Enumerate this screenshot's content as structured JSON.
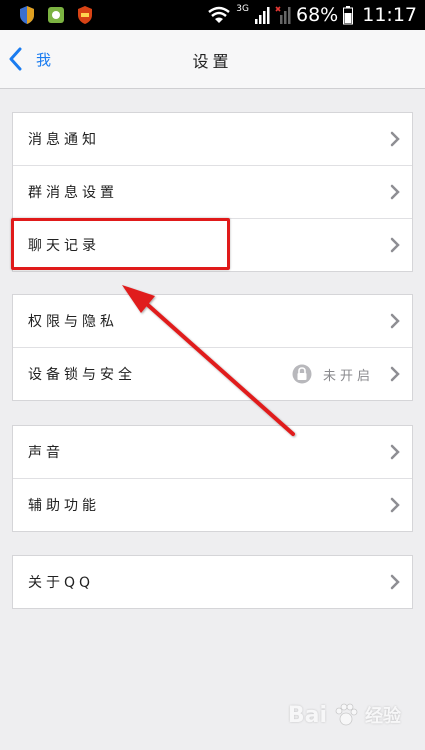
{
  "status_bar": {
    "network": "3G",
    "battery_percent": "68%",
    "time": "11:17"
  },
  "nav": {
    "back_label": "我",
    "title": "设置"
  },
  "groups": [
    {
      "items": [
        {
          "label": "消息通知"
        },
        {
          "label": "群消息设置"
        },
        {
          "label": "聊天记录"
        }
      ]
    },
    {
      "items": [
        {
          "label": "权限与隐私"
        },
        {
          "label": "设备锁与安全",
          "value": "未开启"
        }
      ]
    },
    {
      "items": [
        {
          "label": "声音"
        },
        {
          "label": "辅助功能"
        }
      ]
    },
    {
      "items": [
        {
          "label": "关于QQ"
        }
      ]
    }
  ],
  "watermark": {
    "brand": "Bai",
    "suffix": "经验"
  },
  "colors": {
    "accent": "#1a7cf0",
    "annotation": "#e01a1a",
    "background": "#eeeef0"
  }
}
